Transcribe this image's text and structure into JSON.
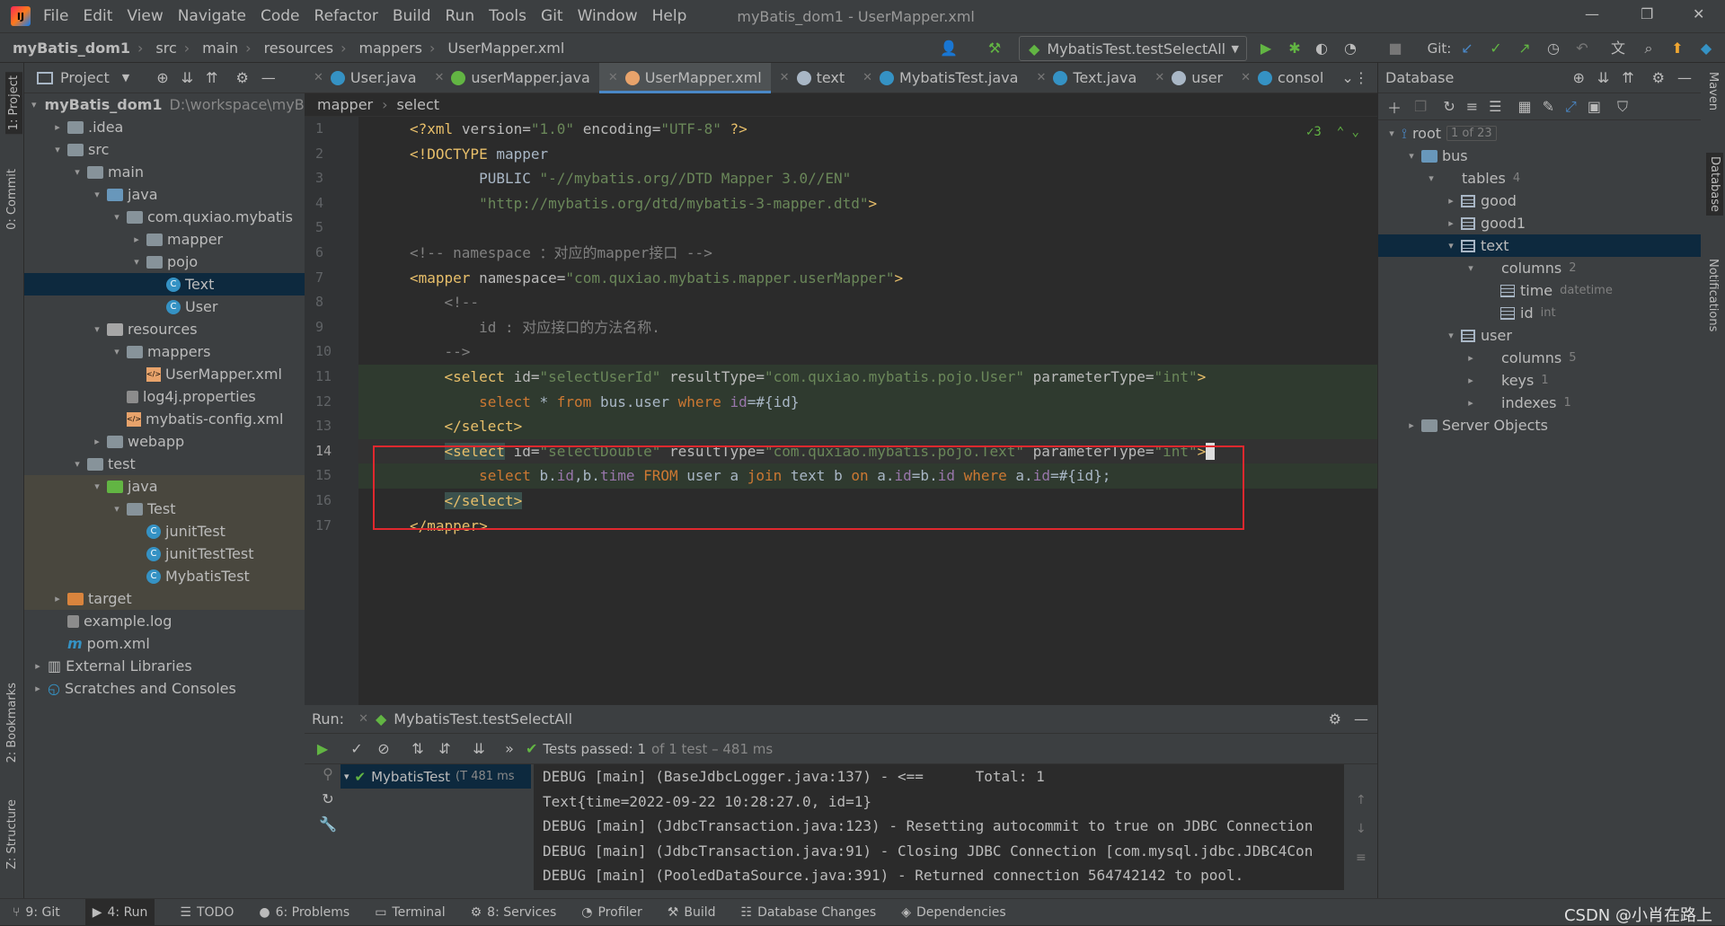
{
  "menubar": {
    "items": [
      "File",
      "Edit",
      "View",
      "Navigate",
      "Code",
      "Refactor",
      "Build",
      "Run",
      "Tools",
      "Git",
      "Window",
      "Help"
    ],
    "window_title": "myBatis_dom1 - UserMapper.xml"
  },
  "navbar": {
    "crumbs": [
      "myBatis_dom1",
      "src",
      "main",
      "resources",
      "mappers",
      "UserMapper.xml"
    ],
    "run_config": "MybatisTest.testSelectAll",
    "git_label": "Git:"
  },
  "project": {
    "header": "Project",
    "tree": [
      {
        "label": "myBatis_dom1",
        "path": "D:\\workspace\\myBa",
        "indent": 0,
        "arrow": "▾",
        "icon": "folder",
        "bold": true
      },
      {
        "label": ".idea",
        "indent": 1,
        "arrow": "▸",
        "icon": "folder"
      },
      {
        "label": "src",
        "indent": 1,
        "arrow": "▾",
        "icon": "folder"
      },
      {
        "label": "main",
        "indent": 2,
        "arrow": "▾",
        "icon": "folder"
      },
      {
        "label": "java",
        "indent": 3,
        "arrow": "▾",
        "icon": "src"
      },
      {
        "label": "com.quxiao.mybatis",
        "indent": 4,
        "arrow": "▾",
        "icon": "folder"
      },
      {
        "label": "mapper",
        "indent": 5,
        "arrow": "▸",
        "icon": "folder"
      },
      {
        "label": "pojo",
        "indent": 5,
        "arrow": "▾",
        "icon": "folder"
      },
      {
        "label": "Text",
        "indent": 6,
        "arrow": "",
        "icon": "class",
        "selected": true
      },
      {
        "label": "User",
        "indent": 6,
        "arrow": "",
        "icon": "class"
      },
      {
        "label": "resources",
        "indent": 3,
        "arrow": "▾",
        "icon": "res"
      },
      {
        "label": "mappers",
        "indent": 4,
        "arrow": "▾",
        "icon": "folder"
      },
      {
        "label": "UserMapper.xml",
        "indent": 5,
        "arrow": "",
        "icon": "xml"
      },
      {
        "label": "log4j.properties",
        "indent": 4,
        "arrow": "",
        "icon": "file"
      },
      {
        "label": "mybatis-config.xml",
        "indent": 4,
        "arrow": "",
        "icon": "xml"
      },
      {
        "label": "webapp",
        "indent": 3,
        "arrow": "▸",
        "icon": "folder"
      },
      {
        "label": "test",
        "indent": 2,
        "arrow": "▾",
        "icon": "folder"
      },
      {
        "label": "java",
        "indent": 3,
        "arrow": "▾",
        "icon": "test",
        "test": true
      },
      {
        "label": "Test",
        "indent": 4,
        "arrow": "▾",
        "icon": "folder",
        "test": true
      },
      {
        "label": "junitTest",
        "indent": 5,
        "arrow": "",
        "icon": "class",
        "test": true
      },
      {
        "label": "junitTestTest",
        "indent": 5,
        "arrow": "",
        "icon": "class",
        "test": true
      },
      {
        "label": "MybatisTest",
        "indent": 5,
        "arrow": "",
        "icon": "class",
        "test": true
      },
      {
        "label": "target",
        "indent": 1,
        "arrow": "▸",
        "icon": "orange",
        "test": true
      },
      {
        "label": "example.log",
        "indent": 1,
        "arrow": "",
        "icon": "file"
      },
      {
        "label": "pom.xml",
        "indent": 1,
        "arrow": "",
        "icon": "m"
      },
      {
        "label": "External Libraries",
        "indent": 0,
        "arrow": "▸",
        "icon": "lib"
      },
      {
        "label": "Scratches and Consoles",
        "indent": 0,
        "arrow": "▸",
        "icon": "scratch"
      }
    ]
  },
  "editor": {
    "tabs": [
      {
        "label": "User.java",
        "color": "#3592c4"
      },
      {
        "label": "userMapper.java",
        "color": "#62b543"
      },
      {
        "label": "UserMapper.xml",
        "color": "#e8a36b",
        "active": true
      },
      {
        "label": "text",
        "color": "#a9b7c6"
      },
      {
        "label": "MybatisTest.java",
        "color": "#3592c4"
      },
      {
        "label": "Text.java",
        "color": "#3592c4"
      },
      {
        "label": "user",
        "color": "#a9b7c6"
      },
      {
        "label": "consol",
        "color": "#3592c4"
      }
    ],
    "breadcrumb": [
      "mapper",
      "select"
    ],
    "inspection_count": "3",
    "line_numbers": [
      "1",
      "2",
      "3",
      "4",
      "5",
      "6",
      "7",
      "8",
      "9",
      "10",
      "11",
      "12",
      "13",
      "14",
      "15",
      "16",
      "17"
    ]
  },
  "run": {
    "label": "Run:",
    "config": "MybatisTest.testSelectAll",
    "status_passed": "Tests passed: 1",
    "status_rest": "of 1 test – 481 ms",
    "tree_item": "MybatisTest",
    "tree_time": "(T 481 ms",
    "console": [
      "DEBUG [main] (BaseJdbcLogger.java:137) - <==      Total: 1",
      "Text{time=2022-09-22 10:28:27.0, id=1}",
      "DEBUG [main] (JdbcTransaction.java:123) - Resetting autocommit to true on JDBC Connection",
      "DEBUG [main] (JdbcTransaction.java:91) - Closing JDBC Connection [com.mysql.jdbc.JDBC4Con",
      "DEBUG [main] (PooledDataSource.java:391) - Returned connection 564742142 to pool."
    ]
  },
  "database": {
    "header": "Database",
    "tree": [
      {
        "label": "root",
        "extra": "1 of 23",
        "indent": 0,
        "arrow": "▾",
        "icon": "root"
      },
      {
        "label": "bus",
        "indent": 1,
        "arrow": "▾",
        "icon": "db"
      },
      {
        "label": "tables",
        "extra": "4",
        "indent": 2,
        "arrow": "▾",
        "icon": "folder"
      },
      {
        "label": "good",
        "indent": 3,
        "arrow": "▸",
        "icon": "table"
      },
      {
        "label": "good1",
        "indent": 3,
        "arrow": "▸",
        "icon": "table"
      },
      {
        "label": "text",
        "indent": 3,
        "arrow": "▾",
        "icon": "table",
        "selected": true
      },
      {
        "label": "columns",
        "extra": "2",
        "indent": 4,
        "arrow": "▾",
        "icon": "folder"
      },
      {
        "label": "time",
        "extra": "datetime",
        "indent": 5,
        "arrow": "",
        "icon": "col"
      },
      {
        "label": "id",
        "extra": "int",
        "indent": 5,
        "arrow": "",
        "icon": "col"
      },
      {
        "label": "user",
        "indent": 3,
        "arrow": "▾",
        "icon": "table"
      },
      {
        "label": "columns",
        "extra": "5",
        "indent": 4,
        "arrow": "▸",
        "icon": "folder"
      },
      {
        "label": "keys",
        "extra": "1",
        "indent": 4,
        "arrow": "▸",
        "icon": "folder"
      },
      {
        "label": "indexes",
        "extra": "1",
        "indent": 4,
        "arrow": "▸",
        "icon": "folder"
      },
      {
        "label": "Server Objects",
        "indent": 1,
        "arrow": "▸",
        "icon": "server"
      }
    ]
  },
  "side_strips": {
    "left": [
      "1: Project",
      "0: Commit",
      "2: Bookmarks",
      "Z: Structure"
    ],
    "right": [
      "Maven",
      "Database",
      "Notifications"
    ]
  },
  "statusbar": {
    "items": [
      "9: Git",
      "4: Run",
      "TODO",
      "6: Problems",
      "Terminal",
      "8: Services",
      "Profiler",
      "Build",
      "Database Changes",
      "Dependencies"
    ],
    "watermark": "CSDN @小肖在路上"
  }
}
